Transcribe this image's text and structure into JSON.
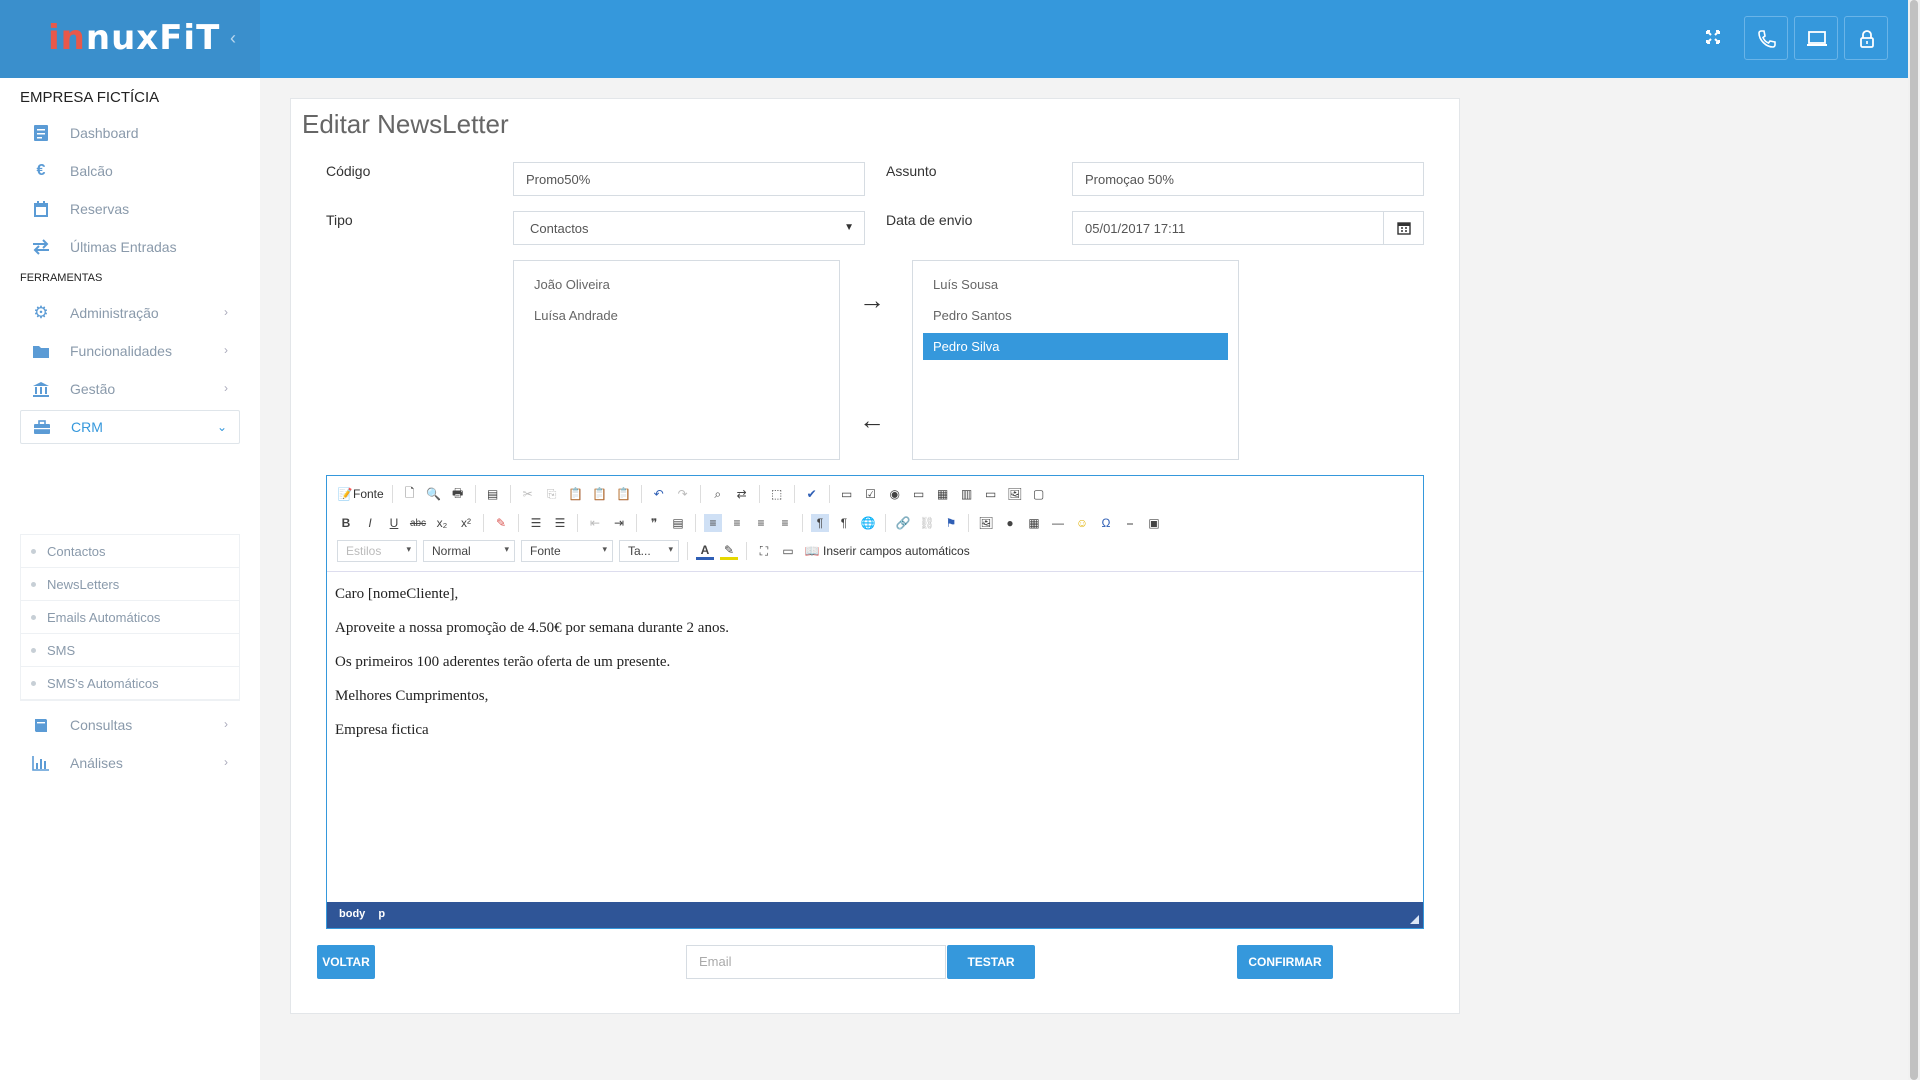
{
  "header": {
    "logo_prefix": "in",
    "logo_suffix": "nuxFiT",
    "collapse_symbol": "‹",
    "icons": [
      "expand-icon",
      "phone-icon",
      "monitor-icon",
      "lock-icon"
    ]
  },
  "sidebar": {
    "company": "EMPRESA FICTÍCIA",
    "items_top": [
      {
        "label": "Dashboard",
        "icon": "dashboard-icon"
      },
      {
        "label": "Balcão",
        "icon": "euro-icon"
      },
      {
        "label": "Reservas",
        "icon": "calendar-icon"
      },
      {
        "label": "Últimas Entradas",
        "icon": "arrows-icon"
      }
    ],
    "section_tools": "FERRAMENTAS",
    "items_tools": [
      {
        "label": "Administração",
        "icon": "gear-icon"
      },
      {
        "label": "Funcionalidades",
        "icon": "folder-icon"
      },
      {
        "label": "Gestão",
        "icon": "bank-icon"
      },
      {
        "label": "CRM",
        "icon": "briefcase-icon"
      }
    ],
    "crm_sub": [
      "Contactos",
      "NewsLetters",
      "Emails Automáticos",
      "SMS",
      "SMS's Automáticos"
    ],
    "items_bottom": [
      {
        "label": "Consultas",
        "icon": "book-icon"
      },
      {
        "label": "Análises",
        "icon": "bar-chart-icon"
      }
    ]
  },
  "form": {
    "title": "Editar NewsLetter",
    "codigo_label": "Código",
    "codigo_value": "Promo50%",
    "assunto_label": "Assunto",
    "assunto_value": "Promoçao 50%",
    "tipo_label": "Tipo",
    "tipo_value": "Contactos",
    "data_label": "Data de envio",
    "data_value": "05/01/2017 17:11",
    "available": [
      "João Oliveira",
      "Luísa Andrade"
    ],
    "selected": [
      "Luís Sousa",
      "Pedro Santos",
      "Pedro Silva"
    ],
    "selected_highlight": "Pedro Silva",
    "arrow_right": "→",
    "arrow_left": "←"
  },
  "editor": {
    "fonte_btn": "Fonte",
    "estilos": "Estilos",
    "formato": "Normal",
    "fonte_combo": "Fonte",
    "tamanho": "Ta...",
    "inserir": "Inserir campos automáticos",
    "bold": "B",
    "italic": "I",
    "underline": "U",
    "strike": "abc",
    "sub": "x₂",
    "sup": "x²",
    "omega": "Ω",
    "paragraphs": [
      "Caro [nomeCliente],",
      "Aproveite a nossa promoção de 4.50€ por semana durante 2 anos.",
      "Os primeiros 100 aderentes terão oferta de um presente.",
      "Melhores Cumprimentos,",
      "Empresa fictica"
    ],
    "status_body": "body",
    "status_p": "p"
  },
  "actions": {
    "voltar": "VOLTAR",
    "email_placeholder": "Email",
    "testar": "TESTAR",
    "confirmar": "CONFIRMAR"
  },
  "colors": {
    "primary": "#3598dc",
    "status_bar": "#2f5597",
    "logo_red": "#e8584a"
  }
}
